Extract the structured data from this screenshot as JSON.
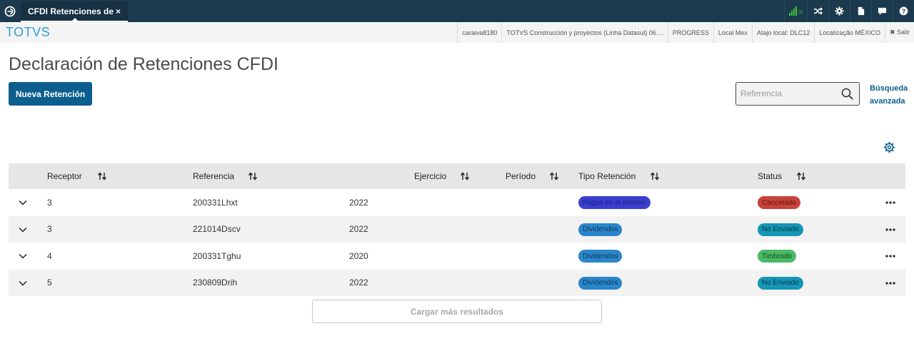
{
  "topbar": {
    "tab_label": "CFDI Retenciones de",
    "tab_close": "×",
    "signal_label": "DI"
  },
  "subbar": {
    "brand": "TOTVS",
    "items": [
      "caraiva8180",
      "TOTVS Construcción y proyectos (Linha Datasul) 06....",
      "PROGRESS",
      "Local Mex",
      "Atajo local: DLC12",
      "Localização MÉXICO"
    ],
    "salir": "✖ Salir"
  },
  "page": {
    "title": "Declaración de Retenciones CFDI",
    "new_button": "Nueva Retención",
    "search_placeholder": "Referencia",
    "advanced_search": "Búsqueda avanzada",
    "load_more": "Cargar más resultados"
  },
  "table": {
    "headers": {
      "receptor": "Receptor",
      "referencia": "Referencia",
      "ejercicio": "Ejercicio",
      "periodo": "Período",
      "tipo": "Tipo Retención",
      "status": "Status"
    },
    "rows": [
      {
        "receptor": "3",
        "referencia": "200331Lhxt",
        "ejercicio": "2022",
        "tipo": "Pagos en el exterior",
        "status": "Cancelado"
      },
      {
        "receptor": "3",
        "referencia": "221014Dscv",
        "ejercicio": "2022",
        "tipo": "Dividendos",
        "status": "No Enviado"
      },
      {
        "receptor": "4",
        "referencia": "200331Tghu",
        "ejercicio": "2020",
        "tipo": "Dividendos",
        "status": "Timbrado"
      },
      {
        "receptor": "5",
        "referencia": "230809Drih",
        "ejercicio": "2022",
        "tipo": "Dividendos",
        "status": "No Enviado"
      }
    ]
  },
  "colors": {
    "topbar": "#1c3a4d",
    "primary": "#0c5e8e",
    "brand": "#2d9fd9",
    "badge_pagos": "#3b3fd0",
    "badge_dividendos": "#2a86c9",
    "badge_cancelado": "#c8433a",
    "badge_no_enviado": "#1596b6",
    "badge_timbrado": "#4bb866"
  }
}
